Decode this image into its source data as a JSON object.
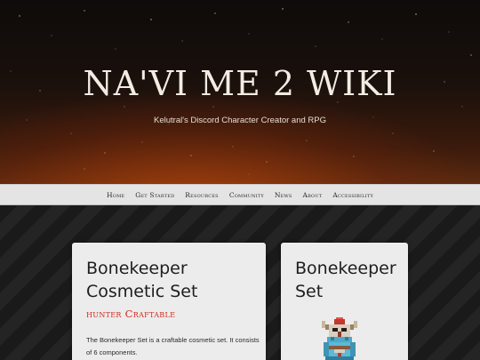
{
  "hero": {
    "title": "NA'VI ME 2 WIKI",
    "tagline": "Kelutral's Discord Character Creator and RPG"
  },
  "nav": {
    "items": [
      "Home",
      "Get Started",
      "Resources",
      "Community",
      "News",
      "About",
      "Accessibility"
    ]
  },
  "main_card": {
    "title": "Bonekeeper Cosmetic Set",
    "subtitle": "hunter Craftable",
    "description": "The Bonekeeper Set is a craftable cosmetic set. It consists of 6 components."
  },
  "side_card": {
    "title": "Bonekeeper Set",
    "image_icon": "bonekeeper-sprite"
  },
  "colors": {
    "accent_red": "#d12a1e",
    "nav_bg": "#e4e4e4",
    "card_bg": "#ececec",
    "hero_glow": "#be460a"
  }
}
